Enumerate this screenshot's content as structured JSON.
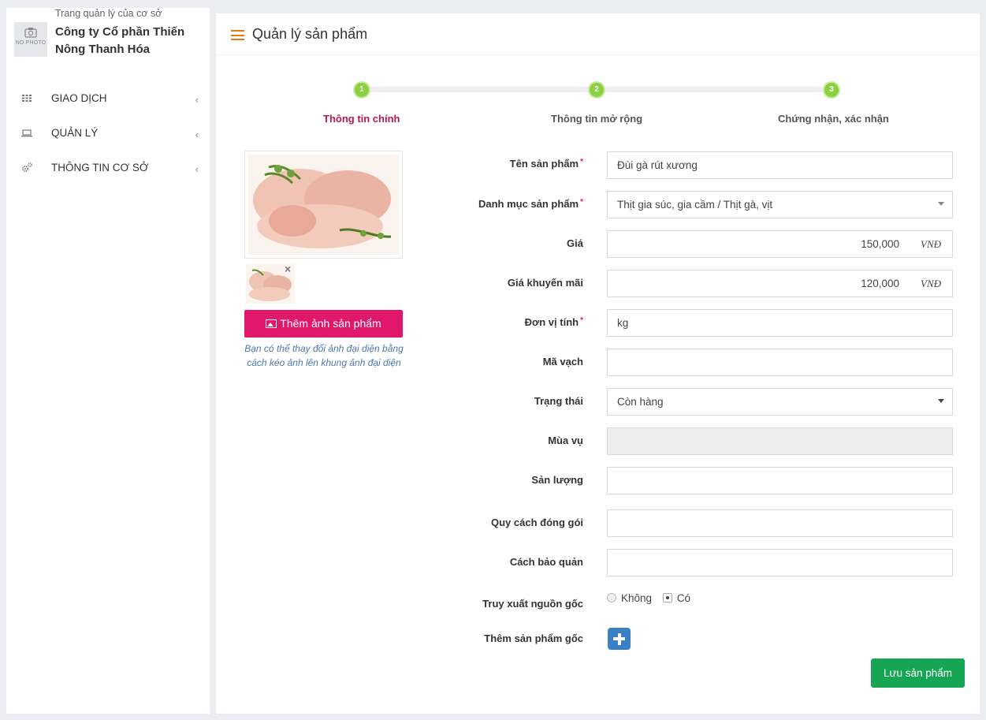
{
  "sidebar": {
    "profile": {
      "photo_label": "NO PHOTO",
      "subtitle": "Trang quản lý của cơ sở",
      "name": "Công ty Cổ phần Thiến Nông Thanh Hóa"
    },
    "items": [
      {
        "label": "GIAO DỊCH",
        "icon": "grid-icon"
      },
      {
        "label": "QUẢN LÝ",
        "icon": "laptop-icon"
      },
      {
        "label": "THÔNG TIN CƠ SỞ",
        "icon": "gears-icon"
      }
    ]
  },
  "header": {
    "title": "Quản lý sản phẩm"
  },
  "steps": [
    {
      "number": "1",
      "label": "Thông tin chính",
      "active": true
    },
    {
      "number": "2",
      "label": "Thông tin mở rộng",
      "active": false
    },
    {
      "number": "3",
      "label": "Chứng nhận, xác nhận",
      "active": false
    }
  ],
  "image_panel": {
    "add_button": "Thêm ảnh sản phẩm",
    "hint": "Bạn có thể thay đổi ảnh đại diện bằng cách kéo ảnh lên khung ảnh đại diện"
  },
  "form": {
    "name": {
      "label": "Tên sản phẩm",
      "value": "Đùi gà rút xương"
    },
    "category": {
      "label": "Danh mục sản phẩm",
      "value": "Thịt gia súc, gia cầm / Thịt gà, vịt"
    },
    "price": {
      "label": "Giá",
      "value": "150,000",
      "unit": "VNĐ"
    },
    "promo_price": {
      "label": "Giá khuyến mãi",
      "value": "120,000",
      "unit": "VNĐ"
    },
    "unit": {
      "label": "Đơn vị tính",
      "value": "kg"
    },
    "barcode": {
      "label": "Mã vạch",
      "value": ""
    },
    "status": {
      "label": "Trạng thái",
      "value": "Còn hàng"
    },
    "season": {
      "label": "Mùa vụ",
      "value": ""
    },
    "output": {
      "label": "Sản lượng",
      "value": ""
    },
    "packaging": {
      "label": "Quy cách đóng gói",
      "value": ""
    },
    "storage": {
      "label": "Cách bảo quản",
      "value": ""
    },
    "traceability": {
      "label": "Truy xuất nguồn gốc",
      "option_no": "Không",
      "option_yes": "Có",
      "selected": "Có"
    },
    "origin_product": {
      "label": "Thêm sản phẩm gốc"
    },
    "required_mark": "*"
  },
  "actions": {
    "save": "Lưu sản phẩm"
  },
  "colors": {
    "accent_orange": "#e8790f",
    "step_green": "#8bd042",
    "active_step": "#b61a4e",
    "add_image_button": "#e0176b",
    "save_button": "#16a552",
    "plus_button": "#3b7fc4"
  }
}
